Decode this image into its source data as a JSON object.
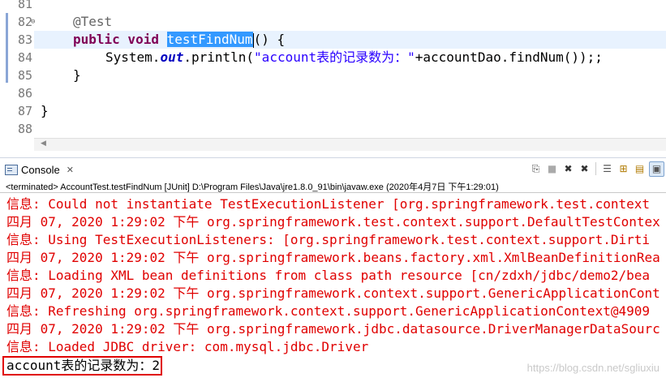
{
  "editor": {
    "lines": [
      {
        "num": "81"
      },
      {
        "num": "82",
        "text": "@Test"
      },
      {
        "num": "83",
        "kw": "public void ",
        "selected": "testFindNum",
        "rest": "() {"
      },
      {
        "num": "84",
        "pre": "System.",
        "field": "out",
        "mid": ".println(",
        "str": "\"account表的记录数为：\"",
        "post": "+accountDao.findNum());;"
      },
      {
        "num": "85",
        "text": "}"
      },
      {
        "num": "86"
      },
      {
        "num": "87",
        "text": "}"
      },
      {
        "num": "88"
      }
    ]
  },
  "console": {
    "tab_label": "Console",
    "tab_close": "✕",
    "terminated_text": "<terminated> AccountTest.testFindNum [JUnit] D:\\Program Files\\Java\\jre1.8.0_91\\bin\\javaw.exe (2020年4月7日 下午1:29:01)",
    "lines": [
      "信息: Could not instantiate TestExecutionListener [org.springframework.test.context",
      "四月 07, 2020 1:29:02 下午 org.springframework.test.context.support.DefaultTestContex",
      "信息: Using TestExecutionListeners: [org.springframework.test.context.support.Dirti",
      "四月 07, 2020 1:29:02 下午 org.springframework.beans.factory.xml.XmlBeanDefinitionRea",
      "信息: Loading XML bean definitions from class path resource [cn/zdxh/jdbc/demo2/bea",
      "四月 07, 2020 1:29:02 下午 org.springframework.context.support.GenericApplicationCont",
      "信息: Refreshing org.springframework.context.support.GenericApplicationContext@4909",
      "四月 07, 2020 1:29:02 下午 org.springframework.jdbc.datasource.DriverManagerDataSourc",
      "信息: Loaded JDBC driver: com.mysql.jdbc.Driver"
    ],
    "result_line": "account表的记录数为：2"
  },
  "toolbar_icons": [
    "pin-icon",
    "terminate-icon",
    "remove-launch-icon",
    "remove-all-icon",
    "scroll-lock-icon",
    "word-wrap-icon",
    "show-console-icon",
    "open-console-icon"
  ],
  "watermark": "https://blog.csdn.net/sgliuxiu",
  "colors": {
    "keyword": "#7f0055",
    "string": "#2a00ff",
    "error": "#e00000",
    "selection": "#3399ff"
  }
}
